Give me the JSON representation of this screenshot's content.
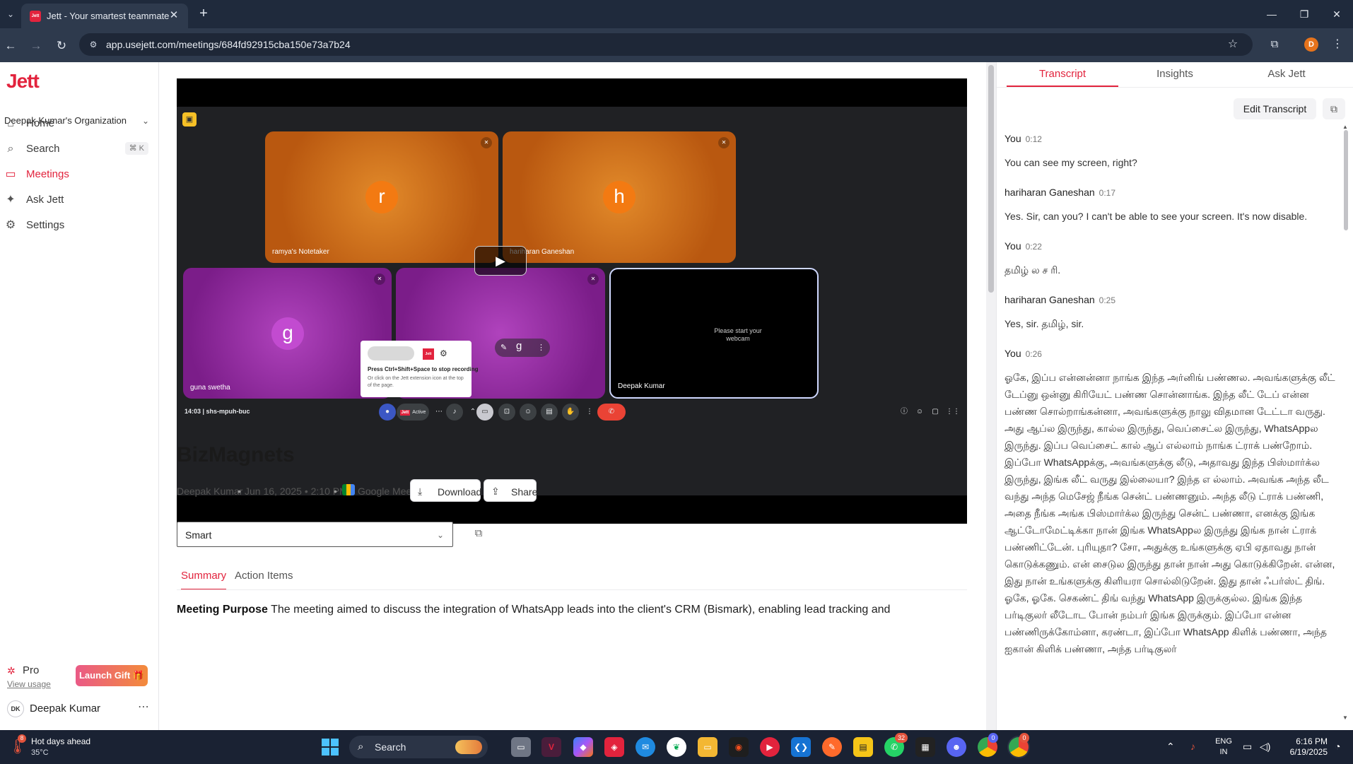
{
  "browser": {
    "tab_title": "Jett - Your smartest teammate",
    "tab_favicon": "Jett",
    "url": "app.usejett.com/meetings/684fd92915cba150e73a7b24",
    "profile_initial": "D",
    "icons": [
      "tab-list-icon",
      "close-icon",
      "plus-icon",
      "back-icon",
      "forward-icon",
      "reload-icon",
      "site-info-icon",
      "star-icon",
      "extensions-icon",
      "kebab-icon"
    ]
  },
  "sidebar": {
    "logo": "Jett",
    "org_name": "Deepak Kumar's Organization",
    "items": [
      {
        "label": "Home",
        "icon": "⌂"
      },
      {
        "label": "Search",
        "icon": "⌕",
        "shortcut": "⌘ K"
      },
      {
        "label": "Meetings",
        "icon": "▭"
      },
      {
        "label": "Ask Jett",
        "icon": "✦"
      },
      {
        "label": "Settings",
        "icon": "⚙"
      }
    ],
    "plan_label": "Pro",
    "view_usage": "View usage",
    "launch_gift": "Launch Gift 🎁",
    "user_initials": "DK",
    "user_name": "Deepak Kumar"
  },
  "video": {
    "participants": [
      {
        "initial": "r",
        "name": "ramya's Notetaker",
        "color": "#f37a12"
      },
      {
        "initial": "h",
        "name": "hariharan Ganeshan",
        "color": "#f37a12"
      },
      {
        "initial": "g",
        "name": "guna swetha",
        "color": "#c24bd0"
      },
      {
        "initial": "g",
        "name": "",
        "color": "#c24bd0"
      },
      {
        "initial": "",
        "name": "Deepak Kumar",
        "color": "#000000"
      }
    ],
    "screen_hint": "Please start your webcam",
    "ext_popup_logo": "Jett",
    "ext_popup_title": "Press Ctrl+Shift+Space to stop recording",
    "ext_popup_sub": "Or click on the Jett extension icon at the top of the page.",
    "meet_time": "14:03  |  shs-mpuh-buc",
    "jett_badge": "Jett",
    "active_label": "Active",
    "participant_count": "5",
    "notification_count": "1"
  },
  "meeting": {
    "title": "BizMagnets",
    "host": "Deepak Kumar",
    "date": "Jun 16, 2025 • 2:10 PM",
    "platform": "Google Meet",
    "download": "Download",
    "share": "Share",
    "template": "Smart",
    "tabs": [
      "Summary",
      "Action Items"
    ],
    "summary_label": "Meeting Purpose",
    "summary_text": "The meeting aimed to discuss the integration of WhatsApp leads into the client's CRM (Bismark), enabling lead tracking and"
  },
  "right_panel": {
    "tabs": [
      "Transcript",
      "Insights",
      "Ask Jett"
    ],
    "edit_button": "Edit Transcript",
    "entries": [
      {
        "speaker": "You",
        "time": "0:12",
        "text": "You can see my screen, right?"
      },
      {
        "speaker": "hariharan Ganeshan",
        "time": "0:17",
        "text": "Yes. Sir, can you? I can't be able to see your screen. It's now disable."
      },
      {
        "speaker": "You",
        "time": "0:22",
        "text": "தமிழ் ல ச ரி."
      },
      {
        "speaker": "hariharan Ganeshan",
        "time": "0:25",
        "text": "Yes, sir. தமிழ், sir."
      },
      {
        "speaker": "You",
        "time": "0:26",
        "text": "ஓகே, இப்ப என்னன்னா நாங்க இந்த அர்னிங் பண்ணல. அவங்களுக்கு லீட் டேப்னு ஒன்னு கிரியேட் பண்ண சொன்னாங்க. இந்த லீட் டேப் என்ன பண்ண சொல்றாங்கன்னா, அவங்களுக்கு நாலு விதமான டேட்டா வருது. அது ஆப்ல இருந்து, கால்ல இருந்து, வெப்சைட்ல இருந்து, WhatsAppல இருந்து. இப்ப வெப்சைட் கால் ஆப் எல்லாம் நாங்க ட்ராக் பண்றோம். இப்போ WhatsAppக்கு, அவங்களுக்கு லீடு, அதாவது இந்த பிஸ்மார்க்ல இருந்து, இங்க லீட் வருது இல்லையா? இந்த எ ல்லாம். அவங்க அந்த லீட வந்து அந்த மெசேஜ் நீங்க சென்ட் பண்ணனும். அந்த லீடு ட்ராக் பண்ணி, அதை நீங்க அங்க பிஸ்மார்க்ல இருந்து சென்ட் பண்ணா, எனக்கு இங்க ஆட்டோமேட்டிக்கா நான் இங்க WhatsAppல இருந்து இங்க நான் ட்ராக் பண்ணிட்டேன். புரியுதா? சோ, அதுக்கு உங்களுக்கு ஏபி ஏதாவது நான் கொடுக்கணும். என் சைடுல இருந்து தான் நான் அது கொடுக்கிறேன். என்ன, இது நான் உங்களுக்கு கிளியரா சொல்லிடுறேன். இது தான் ஃபர்ஸ்ட் திங். ஓகே, ஓகே. செகண்ட் திங் வந்து WhatsApp இருக்குல்ல. இங்க இந்த பர்டிகுலர் லீடோட போன் நம்பர் இங்க இருக்கும். இப்போ என்ன பண்ணிருக்கோம்னா, கரண்டா, இப்போ WhatsApp கிளிக் பண்ணா, அந்த ஐகான் கிளிக் பண்ணா, அந்த பர்டிகுலர்"
      }
    ]
  },
  "taskbar": {
    "weather_title": "Hot days ahead",
    "weather_temp": "35°C",
    "weather_badge": "8",
    "search_label": "Search",
    "whatsapp_badge": "32",
    "discord_badge": "0",
    "chrome_badge": "0",
    "lang_top": "ENG",
    "lang_bottom": "IN",
    "time": "6:16 PM",
    "date": "6/19/2025"
  }
}
